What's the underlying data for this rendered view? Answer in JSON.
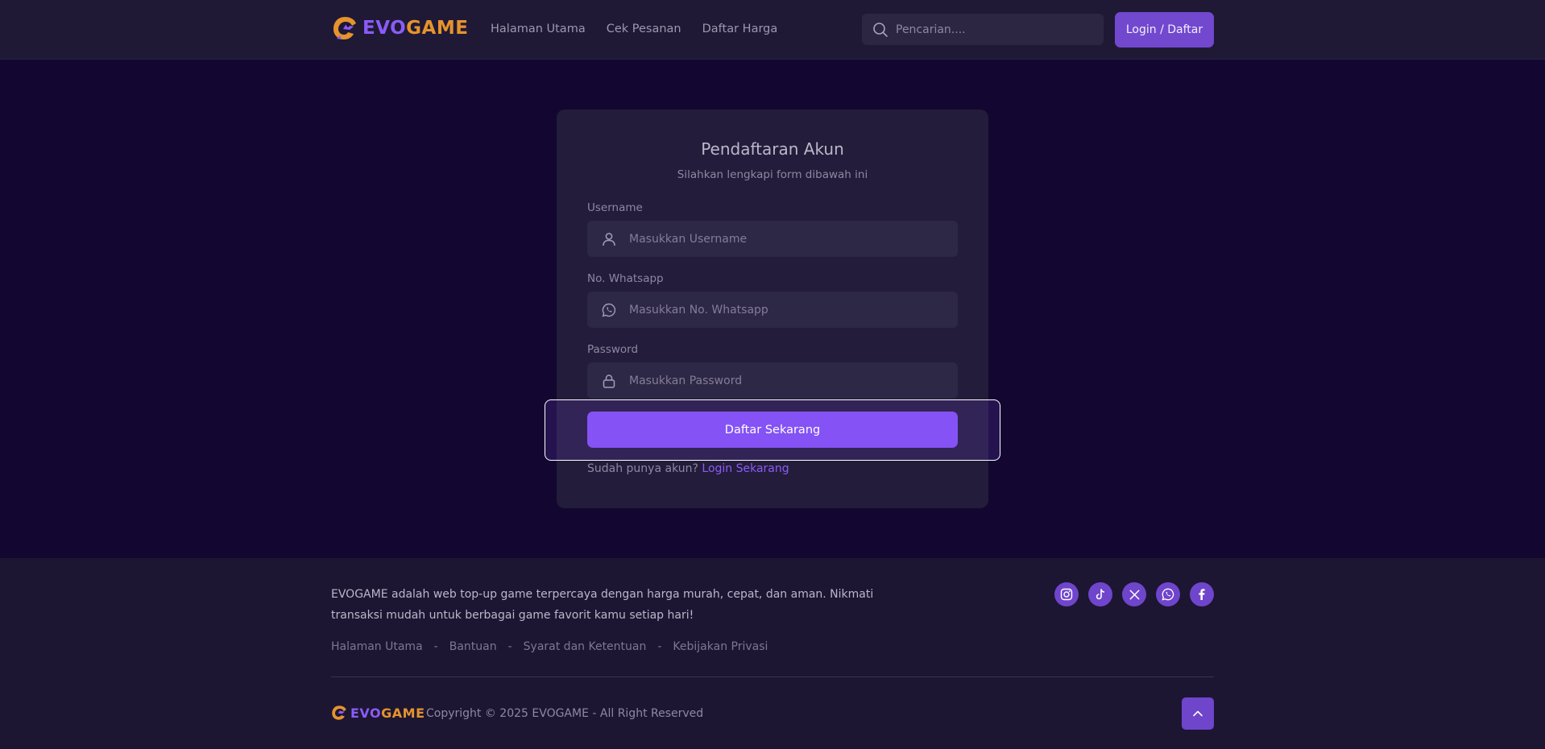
{
  "colors": {
    "background": "#130731",
    "header": "#1f1935",
    "card": "#231c3a",
    "accent": "#8552f5",
    "brand_purple": "#8a5cf6",
    "brand_orange": "#e5932d"
  },
  "header": {
    "logo_part1": "EVO",
    "logo_part2": "GAME",
    "nav": [
      "Halaman Utama",
      "Cek Pesanan",
      "Daftar Harga"
    ],
    "search_placeholder": "Pencarian....",
    "login_label": "Login / Daftar"
  },
  "form": {
    "title": "Pendaftaran Akun",
    "subtitle": "Silahkan lengkapi form dibawah ini",
    "fields": [
      {
        "label": "Username",
        "placeholder": "Masukkan Username",
        "icon": "user-icon"
      },
      {
        "label": "No. Whatsapp",
        "placeholder": "Masukkan No. Whatsapp",
        "icon": "whatsapp-icon"
      },
      {
        "label": "Password",
        "placeholder": "Masukkan Password",
        "icon": "lock-icon"
      }
    ],
    "submit_label": "Daftar Sekarang",
    "have_account_text": "Sudah punya akun?",
    "login_link": "Login Sekarang"
  },
  "footer": {
    "description": "EVOGAME adalah web top-up game terpercaya dengan harga murah, cepat, dan aman. Nikmati transaksi mudah untuk berbagai game favorit kamu setiap hari!",
    "links": [
      "Halaman Utama",
      "Bantuan",
      "Syarat dan Ketentuan",
      "Kebijakan Privasi"
    ],
    "separator": "-",
    "socials": [
      "instagram-icon",
      "tiktok-icon",
      "x-icon",
      "whatsapp-icon",
      "facebook-icon"
    ],
    "copyright": "Copyright © 2025 EVOGAME - All Right Reserved"
  }
}
